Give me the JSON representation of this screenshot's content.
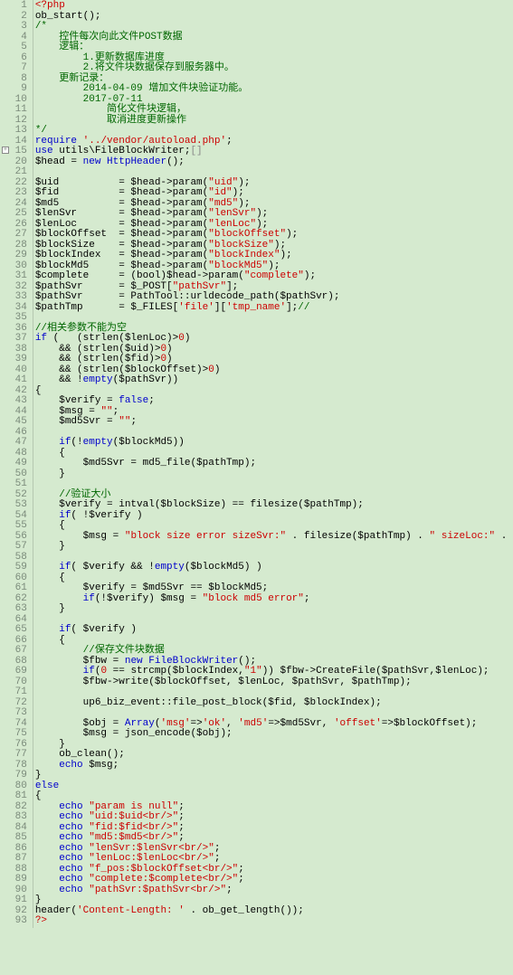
{
  "lines": [
    {
      "n": 1,
      "html": "<span class='red'>&lt;?php</span>"
    },
    {
      "n": 2,
      "html": "ob_start();"
    },
    {
      "n": 3,
      "html": "<span class='cm'>/*</span>"
    },
    {
      "n": 4,
      "html": "<span class='cm'>    控件每次向此文件POST数据</span>"
    },
    {
      "n": 5,
      "html": "<span class='cm'>    逻辑：</span>"
    },
    {
      "n": 6,
      "html": "<span class='cm'>        1.更新数据库进度</span>"
    },
    {
      "n": 7,
      "html": "<span class='cm'>        2.将文件块数据保存到服务器中。</span>"
    },
    {
      "n": 8,
      "html": "<span class='cm'>    更新记录：</span>"
    },
    {
      "n": 9,
      "html": "<span class='cm'>        2014-04-09 增加文件块验证功能。</span>"
    },
    {
      "n": 10,
      "html": "<span class='cm'>        2017-07-11</span>"
    },
    {
      "n": 11,
      "html": "<span class='cm'>            简化文件块逻辑，</span>"
    },
    {
      "n": 12,
      "html": "<span class='cm'>            取消进度更新操作</span>"
    },
    {
      "n": 13,
      "html": "<span class='cm'>*/</span>"
    },
    {
      "n": 14,
      "html": "<span class='kw'>require</span> <span class='str'>'../vendor/autoload.php'</span>;"
    },
    {
      "n": 15,
      "fold": true,
      "html": "<span class='kw'>use</span> utils\\FileBlockWriter;<span class='gray'>[]</span>"
    },
    {
      "n": 20,
      "html": "$head = <span class='kw'>new</span> <span class='blue'>HttpHeader</span>();"
    },
    {
      "n": 21,
      "html": ""
    },
    {
      "n": 22,
      "html": "$uid          = $head-&gt;param(<span class='str'>\"uid\"</span>);"
    },
    {
      "n": 23,
      "html": "$fid          = $head-&gt;param(<span class='str'>\"id\"</span>);"
    },
    {
      "n": 24,
      "html": "$md5          = $head-&gt;param(<span class='str'>\"md5\"</span>);"
    },
    {
      "n": 25,
      "html": "$lenSvr       = $head-&gt;param(<span class='str'>\"lenSvr\"</span>);"
    },
    {
      "n": 26,
      "html": "$lenLoc       = $head-&gt;param(<span class='str'>\"lenLoc\"</span>);"
    },
    {
      "n": 27,
      "html": "$blockOffset  = $head-&gt;param(<span class='str'>\"blockOffset\"</span>);"
    },
    {
      "n": 28,
      "html": "$blockSize    = $head-&gt;param(<span class='str'>\"blockSize\"</span>);"
    },
    {
      "n": 29,
      "html": "$blockIndex   = $head-&gt;param(<span class='str'>\"blockIndex\"</span>);"
    },
    {
      "n": 30,
      "html": "$blockMd5     = $head-&gt;param(<span class='str'>\"blockMd5\"</span>);"
    },
    {
      "n": 31,
      "html": "$complete     = (bool)$head-&gt;param(<span class='str'>\"complete\"</span>);"
    },
    {
      "n": 32,
      "html": "$pathSvr      = $_POST[<span class='str'>\"pathSvr\"</span>];"
    },
    {
      "n": 33,
      "html": "$pathSvr      = PathTool::urldecode_path($pathSvr);"
    },
    {
      "n": 34,
      "html": "$pathTmp      = $_FILES[<span class='str'>'file'</span>][<span class='str'>'tmp_name'</span>];<span class='cm'>//</span>"
    },
    {
      "n": 35,
      "html": ""
    },
    {
      "n": 36,
      "html": "<span class='cm'>//相关参数不能为空</span>"
    },
    {
      "n": 37,
      "html": "<span class='kw'>if</span> (   (strlen($lenLoc)&gt;<span class='num'>0</span>)"
    },
    {
      "n": 38,
      "html": "    &amp;&amp; (strlen($uid)&gt;<span class='num'>0</span>)"
    },
    {
      "n": 39,
      "html": "    &amp;&amp; (strlen($fid)&gt;<span class='num'>0</span>)"
    },
    {
      "n": 40,
      "html": "    &amp;&amp; (strlen($blockOffset)&gt;<span class='num'>0</span>)"
    },
    {
      "n": 41,
      "html": "    &amp;&amp; !<span class='kw'>empty</span>($pathSvr))"
    },
    {
      "n": 42,
      "html": "{"
    },
    {
      "n": 43,
      "html": "    $verify = <span class='kw'>false</span>;"
    },
    {
      "n": 44,
      "html": "    $msg = <span class='str'>\"\"</span>;"
    },
    {
      "n": 45,
      "html": "    $md5Svr = <span class='str'>\"\"</span>;"
    },
    {
      "n": 46,
      "html": ""
    },
    {
      "n": 47,
      "html": "    <span class='kw'>if</span>(!<span class='kw'>empty</span>($blockMd5))"
    },
    {
      "n": 48,
      "html": "    {"
    },
    {
      "n": 49,
      "html": "        $md5Svr = md5_file($pathTmp);"
    },
    {
      "n": 50,
      "html": "    }"
    },
    {
      "n": 51,
      "html": ""
    },
    {
      "n": 52,
      "html": "    <span class='cm'>//验证大小</span>"
    },
    {
      "n": 53,
      "html": "    $verify = intval($blockSize) == filesize($pathTmp);"
    },
    {
      "n": 54,
      "html": "    <span class='kw'>if</span>( !$verify )"
    },
    {
      "n": 55,
      "html": "    {"
    },
    {
      "n": 56,
      "html": "        $msg = <span class='str'>\"block size error sizeSvr:\"</span> . filesize($pathTmp) . <span class='str'>\" sizeLoc:\"</span> . $blockSize;"
    },
    {
      "n": 57,
      "html": "    }"
    },
    {
      "n": 58,
      "html": ""
    },
    {
      "n": 59,
      "html": "    <span class='kw'>if</span>( $verify &amp;&amp; !<span class='kw'>empty</span>($blockMd5) )"
    },
    {
      "n": 60,
      "html": "    {"
    },
    {
      "n": 61,
      "html": "        $verify = $md5Svr == $blockMd5;"
    },
    {
      "n": 62,
      "html": "        <span class='kw'>if</span>(!$verify) $msg = <span class='str'>\"block md5 error\"</span>;"
    },
    {
      "n": 63,
      "html": "    }"
    },
    {
      "n": 64,
      "html": ""
    },
    {
      "n": 65,
      "html": "    <span class='kw'>if</span>( $verify )"
    },
    {
      "n": 66,
      "html": "    {"
    },
    {
      "n": 67,
      "html": "        <span class='cm'>//保存文件块数据</span>"
    },
    {
      "n": 68,
      "html": "        $fbw = <span class='kw'>new</span> <span class='blue'>FileBlockWriter</span>();"
    },
    {
      "n": 69,
      "html": "        <span class='kw'>if</span>(<span class='num'>0</span> == strcmp($blockIndex,<span class='str'>\"1\"</span>)) $fbw-&gt;CreateFile($pathSvr,$lenLoc);"
    },
    {
      "n": 70,
      "html": "        $fbw-&gt;write($blockOffset, $lenLoc, $pathSvr, $pathTmp);"
    },
    {
      "n": 71,
      "html": ""
    },
    {
      "n": 72,
      "html": "        up6_biz_event::file_post_block($fid, $blockIndex);"
    },
    {
      "n": 73,
      "html": ""
    },
    {
      "n": 74,
      "html": "        $obj = <span class='kw'>Array</span>(<span class='str'>'msg'</span>=&gt;<span class='str'>'ok'</span>, <span class='str'>'md5'</span>=&gt;$md5Svr, <span class='str'>'offset'</span>=&gt;$blockOffset);"
    },
    {
      "n": 75,
      "html": "        $msg = json_encode($obj);"
    },
    {
      "n": 76,
      "html": "    }"
    },
    {
      "n": 77,
      "html": "    ob_clean();"
    },
    {
      "n": 78,
      "html": "    <span class='kw'>echo</span> $msg;"
    },
    {
      "n": 79,
      "html": "}"
    },
    {
      "n": 80,
      "html": "<span class='kw'>else</span>"
    },
    {
      "n": 81,
      "html": "{"
    },
    {
      "n": 82,
      "html": "    <span class='kw'>echo</span> <span class='str'>\"param is null\"</span>;"
    },
    {
      "n": 83,
      "html": "    <span class='kw'>echo</span> <span class='str'>\"uid:$uid&lt;br/&gt;\"</span>;"
    },
    {
      "n": 84,
      "html": "    <span class='kw'>echo</span> <span class='str'>\"fid:$fid&lt;br/&gt;\"</span>;"
    },
    {
      "n": 85,
      "html": "    <span class='kw'>echo</span> <span class='str'>\"md5:$md5&lt;br/&gt;\"</span>;"
    },
    {
      "n": 86,
      "html": "    <span class='kw'>echo</span> <span class='str'>\"lenSvr:$lenSvr&lt;br/&gt;\"</span>;"
    },
    {
      "n": 87,
      "html": "    <span class='kw'>echo</span> <span class='str'>\"lenLoc:$lenLoc&lt;br/&gt;\"</span>;"
    },
    {
      "n": 88,
      "html": "    <span class='kw'>echo</span> <span class='str'>\"f_pos:$blockOffset&lt;br/&gt;\"</span>;"
    },
    {
      "n": 89,
      "html": "    <span class='kw'>echo</span> <span class='str'>\"complete:$complete&lt;br/&gt;\"</span>;"
    },
    {
      "n": 90,
      "html": "    <span class='kw'>echo</span> <span class='str'>\"pathSvr:$pathSvr&lt;br/&gt;\"</span>;"
    },
    {
      "n": 91,
      "html": "}"
    },
    {
      "n": 92,
      "html": "header(<span class='str'>'Content-Length: '</span> . ob_get_length());"
    },
    {
      "n": 93,
      "html": "<span class='red'>?&gt;</span>"
    }
  ]
}
